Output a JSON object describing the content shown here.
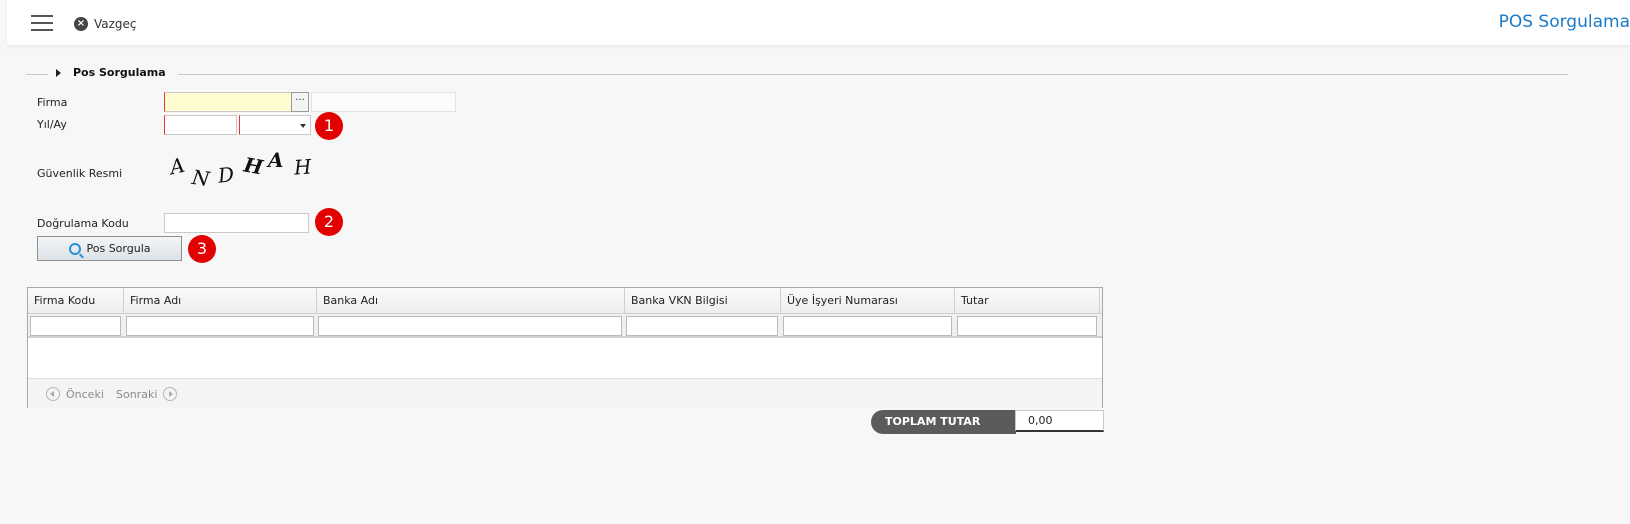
{
  "header": {
    "cancel_label": "Vazgeç",
    "title": "POS Sorgulama"
  },
  "section": {
    "title": "Pos Sorgulama"
  },
  "form": {
    "firma_label": "Firma",
    "yil_ay_label": "Yıl/Ay",
    "guvenlik_label": "Güvenlik Resmi",
    "dogrulama_label": "Doğrulama Kodu",
    "lookup_glyph": "···",
    "captcha_letters": [
      "A",
      "N",
      "D",
      "H",
      "A",
      "H"
    ],
    "query_button_label": "Pos Sorgula"
  },
  "badges": [
    "1",
    "2",
    "3"
  ],
  "grid": {
    "columns": [
      "Firma Kodu",
      "Firma Adı",
      "Banka Adı",
      "Banka VKN Bilgisi",
      "Üye İşyeri Numarası",
      "Tutar"
    ],
    "prev_label": "Önceki",
    "next_label": "Sonraki"
  },
  "total": {
    "label": "TOPLAM TUTAR",
    "value": "0,00"
  },
  "colors": {
    "accent": "#1a7ac8",
    "badge": "#e30000",
    "required_border": "#ee3333",
    "highlight_input": "#fffdd0"
  }
}
